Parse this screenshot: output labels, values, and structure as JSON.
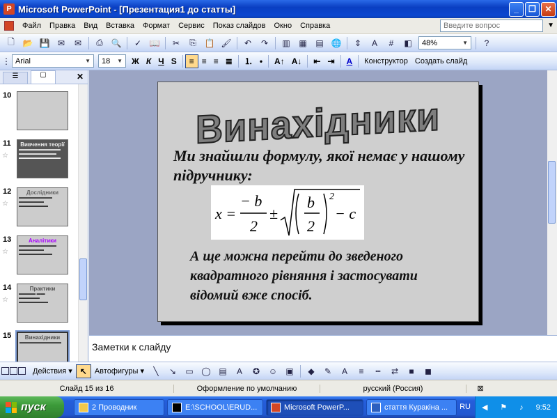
{
  "window": {
    "title": "Microsoft PowerPoint - [Презентация1 до статты]"
  },
  "menu": [
    "Файл",
    "Правка",
    "Вид",
    "Вставка",
    "Формат",
    "Сервис",
    "Показ слайдов",
    "Окно",
    "Справка"
  ],
  "help_placeholder": "Введите вопрос",
  "toolbar": {
    "zoom": "48%",
    "font": "Arial",
    "size": "18",
    "bold": "Ж",
    "italic": "К",
    "underline": "Ч",
    "shadow": "S",
    "design": "Конструктор",
    "new_slide": "Создать слайд"
  },
  "slides_panel": {
    "items": [
      {
        "num": "10",
        "title": ""
      },
      {
        "num": "11",
        "title": "Вивчення теорії"
      },
      {
        "num": "12",
        "title": "Дослідники"
      },
      {
        "num": "13",
        "title": "Аналітики"
      },
      {
        "num": "14",
        "title": "Практики"
      },
      {
        "num": "15",
        "title": "Винахідники"
      }
    ]
  },
  "slide": {
    "title": "Винахідники",
    "text1": "Ми знайшли формулу, якої немає у нашому підручнику:",
    "formula": {
      "lhs": "x =",
      "minus_b": "− b",
      "den": "2",
      "pm": "±",
      "b": "b",
      "two": "2",
      "exp": "2",
      "minus_c": "− c"
    },
    "text2": "А ще можна перейти до зведеного квадратного рівняння і застосувати відомий вже спосіб."
  },
  "notes": "Заметки к слайду",
  "drawbar": {
    "actions": "Действия",
    "autoshapes": "Автофигуры"
  },
  "status": {
    "slide": "Слайд 15 из 16",
    "design": "Оформление по умолчанию",
    "lang": "русский (Россия)"
  },
  "taskbar": {
    "start": "пуск",
    "tasks": [
      "2 Проводник",
      "E:\\SCHOOL\\ERUD...",
      "Microsoft PowerP...",
      "стаття Куракіна ..."
    ],
    "lang": "RU",
    "clock": "9:52"
  }
}
